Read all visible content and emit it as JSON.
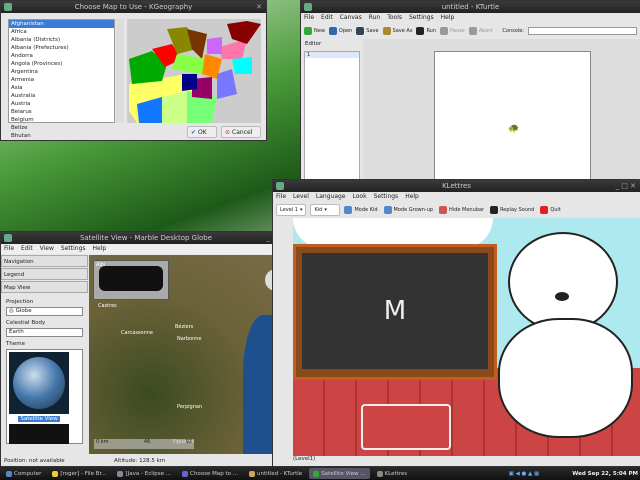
{
  "kgeography": {
    "title": "Choose Map to Use - KGeography",
    "maps": [
      "Afghanistan",
      "Africa",
      "Albania (Districts)",
      "Albania (Prefectures)",
      "Andorra",
      "Angola (Provinces)",
      "Argentina",
      "Armenia",
      "Asia",
      "Australia",
      "Austria",
      "Belarus",
      "Belgium",
      "Belize",
      "Bhutan",
      "Bolivia"
    ],
    "selected": "Afghanistan",
    "ok": "OK",
    "cancel": "Cancel"
  },
  "kturtle": {
    "title": "untitled - KTurtle",
    "menu": [
      "File",
      "Edit",
      "Canvas",
      "Run",
      "Tools",
      "Settings",
      "Help"
    ],
    "toolbar": [
      "New",
      "Open",
      "Save",
      "Save As",
      "Run",
      "Pause",
      "Abort"
    ],
    "console_label": "Console:",
    "editor_label": "Editor",
    "line_number": "1"
  },
  "klettres": {
    "title": "KLettres",
    "menu": [
      "File",
      "Level",
      "Language",
      "Look",
      "Settings",
      "Help"
    ],
    "level": "Level 1",
    "language": "Kid",
    "toolbar": [
      "Mode Kid",
      "Mode Grown-up",
      "Hide Menubar",
      "Replay Sound",
      "Quit"
    ],
    "letter": "M",
    "status": "(Level1)"
  },
  "marble": {
    "title": "Satellite View - Marble Desktop Globe",
    "menu": [
      "File",
      "Edit",
      "View",
      "Settings",
      "Help"
    ],
    "panels": [
      "Navigation",
      "Legend",
      "Map View"
    ],
    "projection_label": "Projection",
    "projection": "Globe",
    "body_label": "Celestial Body",
    "body": "Earth",
    "theme_label": "Theme",
    "theme_selected": "Satellite View",
    "cities": [
      "Albi",
      "Castres",
      "Carcassonne",
      "Narbonne",
      "Béziers",
      "Perpignan",
      "Andorra",
      "Figueres"
    ],
    "scale": [
      "0 km",
      "46",
      "92"
    ],
    "position": "Position: not available",
    "altitude_label": "Altitude:",
    "altitude": "128.5 km"
  },
  "taskbar": {
    "items": [
      "Computer",
      "[roger] - File Br...",
      "[Java - Eclipse ...",
      "Choose Map to ...",
      "untitled - KTurtle",
      "Satellite View ...",
      "KLettres"
    ],
    "active": "Satellite View ...",
    "clock": "Wed Sep 22,  5:04 PM"
  }
}
